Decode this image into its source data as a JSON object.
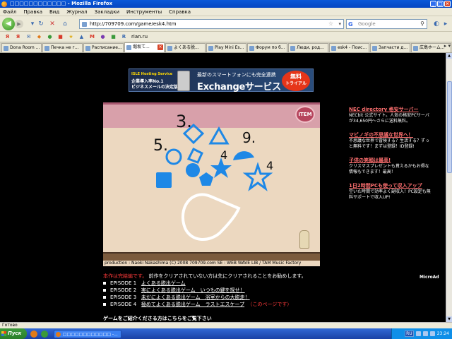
{
  "window": {
    "title": "□□□□□□□□□□□□ - Mozilla Firefox"
  },
  "menu": [
    "Файл",
    "Правка",
    "Вид",
    "Журнал",
    "Закладки",
    "Инструменты",
    "Справка"
  ],
  "nav": {
    "url": "http://709709.com/game/esk4.htm",
    "search_placeholder": "Google"
  },
  "bookmarks": [
    {
      "label": "",
      "color": "#d83a2a",
      "text": "Я"
    },
    {
      "label": "",
      "color": "#d83a2a",
      "text": "Я"
    },
    {
      "label": "",
      "color": "#3a6ab0",
      "text": "✉"
    },
    {
      "label": "",
      "color": "#e07a1a",
      "text": "◆"
    },
    {
      "label": "",
      "color": "#3a9a3a",
      "text": "●"
    },
    {
      "label": "",
      "color": "#d83a2a",
      "text": "■"
    },
    {
      "label": "",
      "color": "#e0b020",
      "text": "★"
    },
    {
      "label": "",
      "color": "#3a6ab0",
      "text": "▲"
    },
    {
      "label": "",
      "color": "#d83a2a",
      "text": "M"
    },
    {
      "label": "",
      "color": "#7a3ab0",
      "text": "●"
    },
    {
      "label": "",
      "color": "#3a9a3a",
      "text": "■"
    },
    {
      "label": "rian.ru",
      "color": "#3a6ab0",
      "text": "R"
    }
  ],
  "tabs": [
    {
      "label": "Dona Room ..."
    },
    {
      "label": "Печка не г..."
    },
    {
      "label": "Расписание..."
    },
    {
      "label": "堀坂て...",
      "active": true
    },
    {
      "label": "よくある脱..."
    },
    {
      "label": "Play Mini Es..."
    },
    {
      "label": "Форум по б..."
    },
    {
      "label": "Люди, род..."
    },
    {
      "label": "esk4 - Поис..."
    },
    {
      "label": "Запчасти д..."
    },
    {
      "label": "広島ホーム..."
    }
  ],
  "banner": {
    "line1": "ISLE Hosting Service",
    "line2": "企業導入率No.1",
    "line3": "ビジネスメールの決定版!",
    "line4": "最新のスマートフォンにも完全連携",
    "line5": "Exchangeサービス",
    "badge_top": "無料",
    "badge_bottom": "トライアル"
  },
  "game": {
    "item_button": "ITEM",
    "numbers": [
      "3.",
      "5.",
      "9.",
      "4",
      "4"
    ],
    "colors": {
      "blue": "#1e88e6",
      "ink": "#111111",
      "wall": "#ecd8c0",
      "top": "#d8a0aa"
    }
  },
  "credits": "production : Naoki Nakashima   (C) 2008   709709.com        SE : WEB WAVE LIB / TAM Music Factory",
  "notice": {
    "red": "本作は完結編です。",
    "rest": "前作をクリアされていない方は先にクリアされることをお勧めします。"
  },
  "episodes": [
    {
      "label": "EPISODE 1",
      "title": "よくある脱出ゲーム"
    },
    {
      "label": "EPISODE 2",
      "title": "実によくある脱出ゲーム　いつもの鍵を探せ！"
    },
    {
      "label": "EPISODE 3",
      "title": "未だによくある脱出ゲーム　浴室からの大脱走！"
    },
    {
      "label": "EPISODE 4",
      "title": "極めてよくある脱出ゲーム　ラストエスケープ",
      "note": "（このページです）"
    }
  ],
  "cutoff_text": "ゲームをご紹介くださる方はこちらをご覧下さい",
  "ads": [
    {
      "title": "NEC directory 格安サーバー",
      "text": "NECbit 公式サイト。人気の格安PCサーバが34,650円〜さらに送料無料。"
    },
    {
      "title": "マビノギの不思議な世界へ！",
      "text": "不思議な世界で冒険する？生活する？ずっと無料です！まずは登録！ID登録!"
    },
    {
      "title": "子供の笑顔は最高!",
      "text": "クリスマスプレゼントも貰えるかもお得な情報もできます！最高！"
    },
    {
      "title": "1日2時間PCも使って収入アップ",
      "text": "空いた時間で効率よく副収入！PC設定も無料サポートで収入UP!"
    }
  ],
  "microad": "MicroAd",
  "status": "Готово",
  "taskbar": {
    "start": "Пуск",
    "task": "□□□□□□□□□□□□ -...",
    "lang": "RU",
    "clock": "23:24"
  }
}
